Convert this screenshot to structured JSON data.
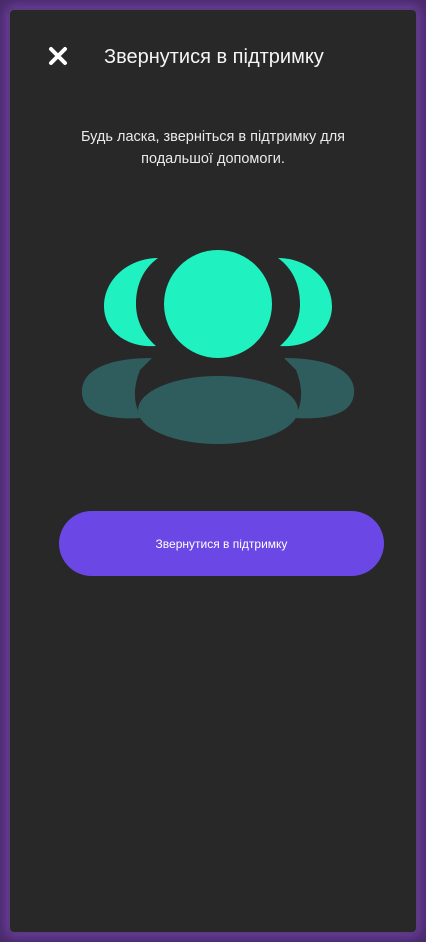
{
  "header": {
    "title": "Звернутися в підтримку",
    "close_icon": "close-icon"
  },
  "main": {
    "message": "Будь ласка, зверніться в підтримку для подальшої допомоги.",
    "illustration_icon": "support-group-icon",
    "button_label": "Звернутися в підтримку"
  },
  "colors": {
    "background": "#282828",
    "accent": "#6b47e6",
    "illustration_primary": "#1ff2c0",
    "illustration_secondary": "#2f5d5e"
  }
}
